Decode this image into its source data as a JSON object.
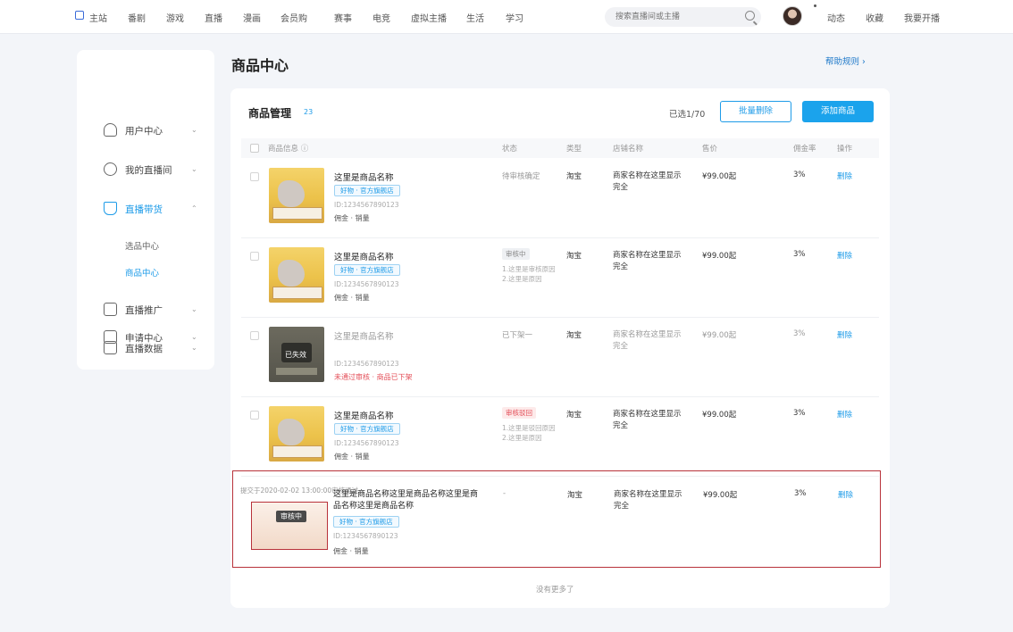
{
  "colors": {
    "accent": "#1d9be8",
    "primary_button": "#1ba3ec",
    "highlight_border": "#b8323a",
    "warning_text": "#e4505a"
  },
  "topnav": {
    "items": [
      "主站",
      "番剧",
      "游戏",
      "直播",
      "漫画",
      "会员购",
      "赛事",
      "电竞",
      "虚拟主播",
      "生活",
      "学习"
    ],
    "search_placeholder": "搜索直播间或主播",
    "right_links": [
      "动态",
      "收藏",
      "我要开播"
    ]
  },
  "sidebar": {
    "items": [
      {
        "label": "用户中心",
        "icon": "user-icon"
      },
      {
        "label": "我的直播间",
        "icon": "live-room-icon"
      },
      {
        "label": "直播带货",
        "icon": "cart-icon",
        "active": true
      },
      {
        "label": "直播推广",
        "icon": "promote-icon"
      },
      {
        "label": "直播数据",
        "icon": "chart-icon"
      },
      {
        "label": "申请中心",
        "icon": "apply-icon"
      }
    ],
    "sub_items": [
      "选品中心",
      "商品中心"
    ]
  },
  "page": {
    "title": "商品中心",
    "top_link": "帮助规则 ›"
  },
  "card": {
    "title": "商品管理",
    "count": "23",
    "selected_info": "已选1/70",
    "btn_batch": "批量删除",
    "btn_add": "添加商品"
  },
  "table": {
    "headers": [
      "商品信息 ⓘ",
      "状态",
      "类型",
      "店铺名称",
      "售价",
      "佣金率",
      "操作"
    ]
  },
  "rows": [
    {
      "name": "这里是商品名称",
      "tag": "好物 · 官方旗舰店",
      "id": "ID:1234567890123",
      "info": "佣金 · 销量",
      "status": "待审核确定",
      "type": "淘宝",
      "shop": "商家名称在这里显示完全",
      "price": "¥99.00起",
      "rate": "3%",
      "op": "删除"
    },
    {
      "name": "这里是商品名称",
      "tag": "好物 · 官方旗舰店",
      "id": "ID:1234567890123",
      "info": "佣金 · 销量",
      "badge": "审核中",
      "note": "1.这里是审核原因 2.这里是原因",
      "type": "淘宝",
      "shop": "商家名称在这里显示完全",
      "price": "¥99.00起",
      "rate": "3%",
      "op": "删除"
    },
    {
      "name": "这里是商品名称",
      "id": "ID:1234567890123",
      "warn": "未通过审核 · 商品已下架",
      "thumb_tag": "已失效",
      "status": "已下架一",
      "type": "淘宝",
      "shop": "商家名称在这里显示完全",
      "price": "¥99.00起",
      "rate": "3%",
      "op": "删除"
    },
    {
      "name": "这里是商品名称",
      "tag": "好物 · 官方旗舰店",
      "id": "ID:1234567890123",
      "info": "佣金 · 销量",
      "badge": "审核驳回",
      "note": "1.这里是驳回原因 2.这里是原因",
      "type": "淘宝",
      "shop": "商家名称在这里显示完全",
      "price": "¥99.00起",
      "rate": "3%",
      "op": "删除"
    },
    {
      "time": "提交于2020-02-02 13:00:00审核通过",
      "name": "这里是商品名称这里是商品名称这里是商品名称这里是商品名称",
      "tag": "好物 · 官方旗舰店",
      "id": "ID:1234567890123",
      "info": "佣金 · 销量",
      "thumb_tag": "审核中",
      "status": "-",
      "type": "淘宝",
      "shop": "商家名称在这里显示完全",
      "price": "¥99.00起",
      "rate": "3%",
      "op": "删除"
    }
  ],
  "load_more": "没有更多了"
}
